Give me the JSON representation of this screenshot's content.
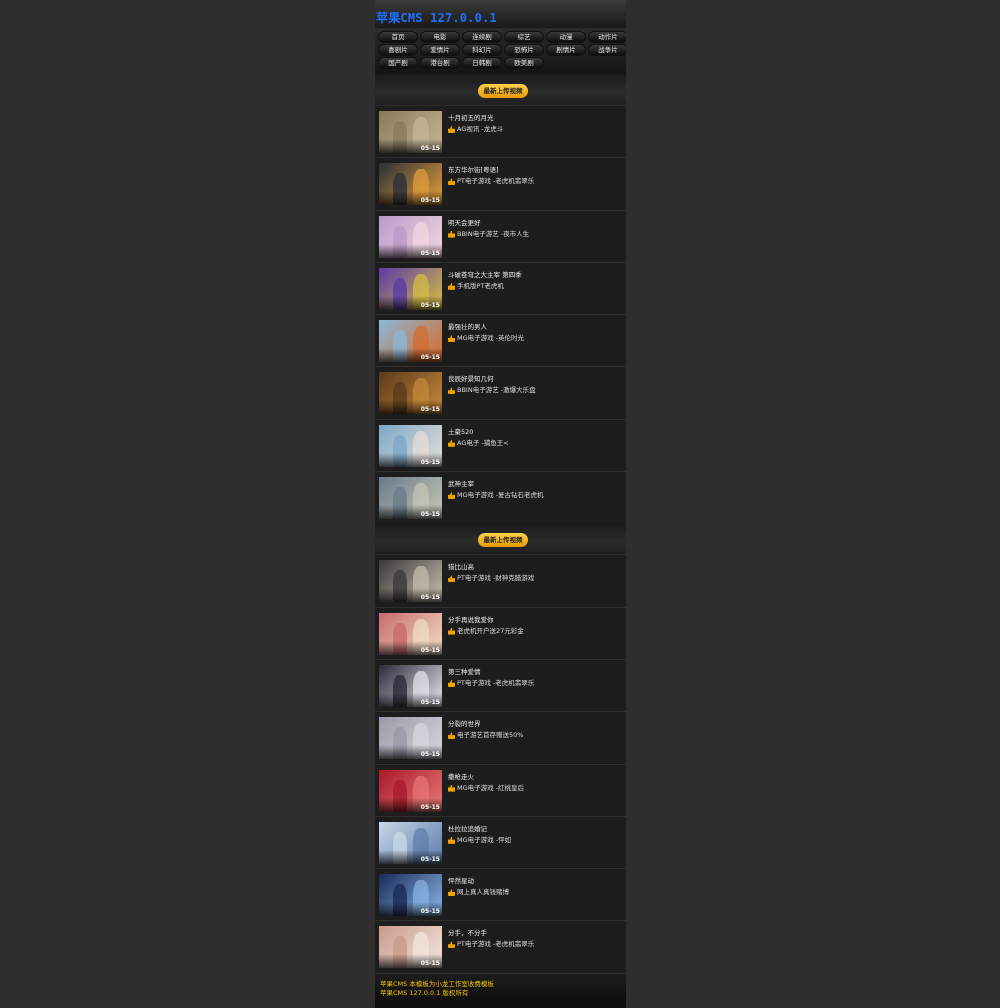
{
  "site": {
    "title": "苹果CMS 127.0.0.1"
  },
  "nav": {
    "rows": [
      [
        "首页",
        "电影",
        "连续剧",
        "综艺",
        "动漫",
        "动作片"
      ],
      [
        "喜剧片",
        "爱情片",
        "科幻片",
        "恐怖片",
        "剧情片",
        "战争片"
      ],
      [
        "国产剧",
        "港台剧",
        "日韩剧",
        "欧美剧"
      ]
    ]
  },
  "sections": [
    {
      "heading": "最新上传视频",
      "items": [
        {
          "title": "十月初五的月光",
          "sub": "AG视讯 -龙虎斗",
          "date": "05-15",
          "colors": [
            "#8a7a5a",
            "#c8b89a"
          ]
        },
        {
          "title": "东方华尔街[粤语]",
          "sub": "PT电子游戏 -老虎机翡翠乐",
          "date": "05-15",
          "colors": [
            "#2a2f38",
            "#e8a03a"
          ]
        },
        {
          "title": "明天会更好",
          "sub": "BBIN电子游艺 -夜市人生",
          "date": "05-15",
          "colors": [
            "#b89ac8",
            "#f4d8e0"
          ]
        },
        {
          "title": "斗破苍穹之大主宰 第四季",
          "sub": "手机版PT老虎机",
          "date": "05-15",
          "colors": [
            "#5a3aa8",
            "#d8c040"
          ]
        },
        {
          "title": "最强壮的男人",
          "sub": "MG电子游戏 -英伦时光",
          "date": "05-15",
          "colors": [
            "#8ab8d8",
            "#d86a28"
          ]
        },
        {
          "title": "良辰好景知几何",
          "sub": "BBIN电子游艺 -激爆大乐盘",
          "date": "05-15",
          "colors": [
            "#5a3a1a",
            "#c88a3a"
          ]
        },
        {
          "title": "土豪520",
          "sub": "AG电子 -捕鱼王<",
          "date": "05-15",
          "colors": [
            "#7aa8c8",
            "#e8e0d8"
          ]
        },
        {
          "title": "武神主宰",
          "sub": "MG电子游戏 -复古钻石老虎机",
          "date": "05-15",
          "colors": [
            "#6a7a8a",
            "#c8c8b8"
          ]
        }
      ]
    },
    {
      "heading": "最新上传视频",
      "items": [
        {
          "title": "猎比山高",
          "sub": "PT电子游戏 -财神克腊游戏",
          "date": "05-15",
          "colors": [
            "#3a3a3a",
            "#c8c0b0"
          ]
        },
        {
          "title": "分手再说我爱你",
          "sub": "老虎机开户送27元彩金",
          "date": "05-15",
          "colors": [
            "#c86a6a",
            "#f0e0c8"
          ]
        },
        {
          "title": "第三种爱情",
          "sub": "PT电子游戏 -老虎机翡翠乐",
          "date": "05-15",
          "colors": [
            "#2a2a3a",
            "#e8e8f0"
          ]
        },
        {
          "title": "分裂的世界",
          "sub": "电子游艺首存赠送50%",
          "date": "05-15",
          "colors": [
            "#9a9aa8",
            "#d8d8e0"
          ]
        },
        {
          "title": "撒枪走火",
          "sub": "MG电子游戏 -红桃皇后",
          "date": "05-15",
          "colors": [
            "#a81a2a",
            "#e87878"
          ]
        },
        {
          "title": "杜拉拉追婚记",
          "sub": "MG电子游戏 -怦如",
          "date": "05-15",
          "colors": [
            "#c8d8e8",
            "#5a7aa8"
          ]
        },
        {
          "title": "怦然星动",
          "sub": "网上真人真钱赌博",
          "date": "05-15",
          "colors": [
            "#1a2a5a",
            "#8ab8e8"
          ]
        },
        {
          "title": "分手，不分手",
          "sub": "PT电子游戏 -老虎机翡翠乐",
          "date": "05-15",
          "colors": [
            "#c89a8a",
            "#f4e8e0"
          ]
        }
      ]
    }
  ],
  "footer": {
    "line1": "苹果CMS 本模板为小龙工作室收费模板",
    "line2": "苹果CMS 127.0.0.1 版权所有"
  }
}
